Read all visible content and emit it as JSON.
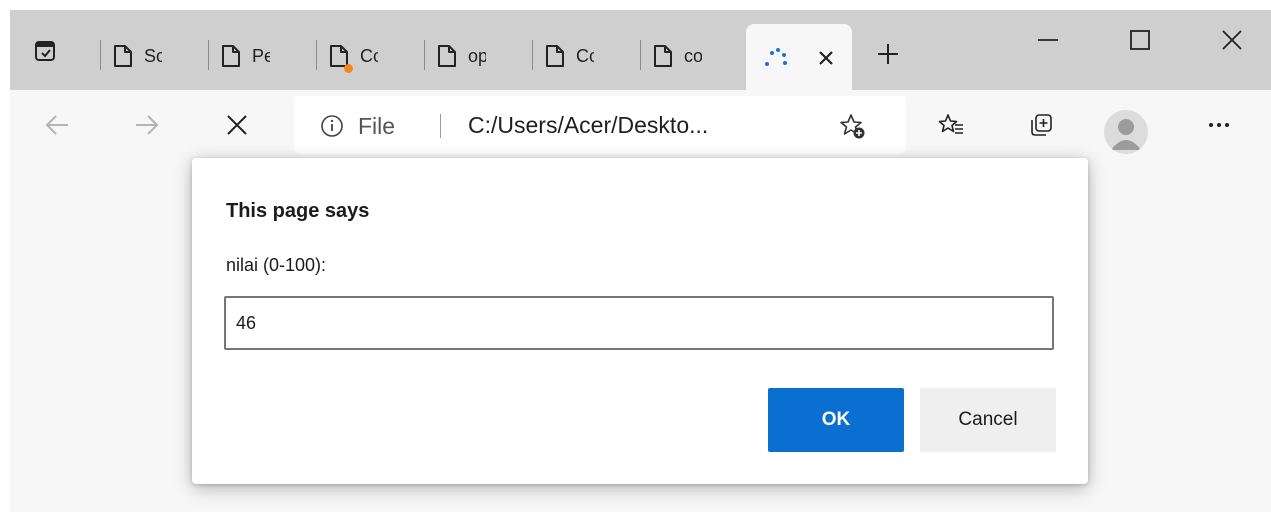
{
  "tabs": [
    {
      "label": "Scr",
      "status_dot": false
    },
    {
      "label": "Per",
      "status_dot": false
    },
    {
      "label": "Cor",
      "status_dot": true
    },
    {
      "label": "ope",
      "status_dot": false
    },
    {
      "label": "Cor",
      "status_dot": false
    },
    {
      "label": "cor",
      "status_dot": false
    }
  ],
  "active_tab": {
    "state": "loading",
    "icon": "loading-spinner-icon"
  },
  "address_bar": {
    "scheme_label": "File",
    "url": "C:/Users/Acer/Deskto..."
  },
  "dialog": {
    "title": "This page says",
    "message": "nilai (0-100):",
    "input_value": "46",
    "ok_label": "OK",
    "cancel_label": "Cancel"
  },
  "colors": {
    "tabstrip_bg": "#cfcfcf",
    "toolbar_bg": "#f7f7f7",
    "primary_button": "#0a6fd1",
    "secondary_button": "#efefef",
    "spinner": "#1a73d9",
    "notification_dot": "#f7851b"
  }
}
